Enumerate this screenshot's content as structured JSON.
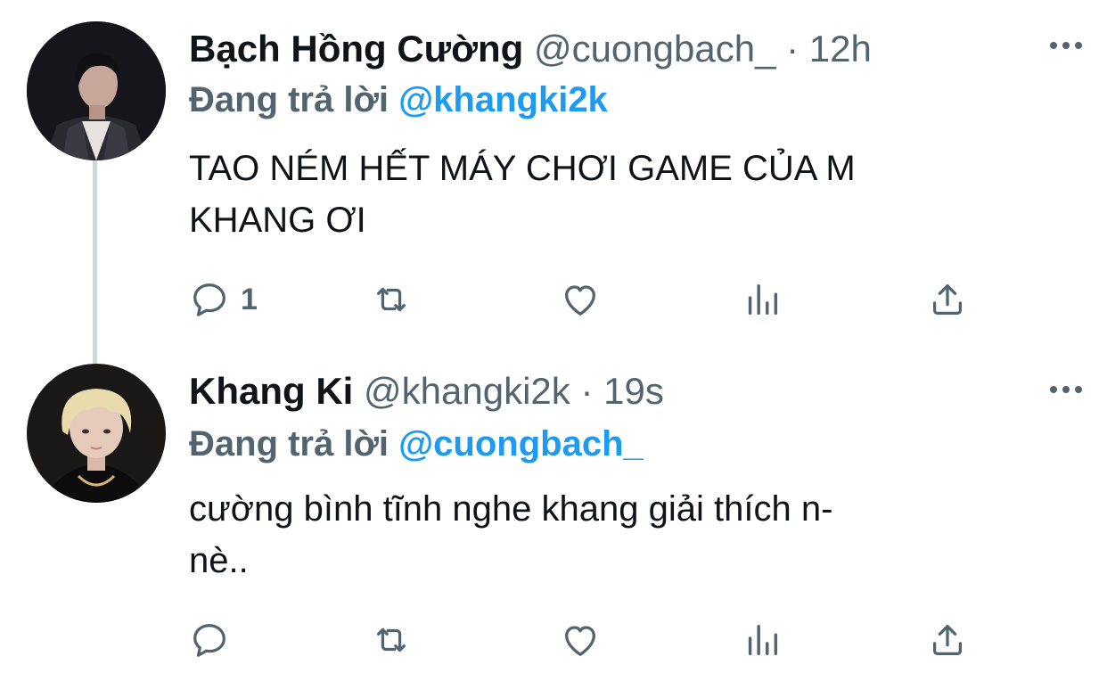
{
  "tweets": [
    {
      "display_name": "Bạch Hồng Cường",
      "handle": "@cuongbach_",
      "separator": "·",
      "time": "12h",
      "replying_prefix": "Đang trả lời",
      "replying_to": "@khangki2k",
      "text": "TAO NÉM HẾT MÁY CHƠI GAME CỦA M\nKHANG ƠI",
      "reply_count": "1"
    },
    {
      "display_name": "Khang Ki",
      "handle": "@khangki2k",
      "separator": "·",
      "time": "19s",
      "replying_prefix": "Đang trả lời",
      "replying_to": "@cuongbach_",
      "text": "cường bình tĩnh nghe khang giải thích n-\nnè..",
      "reply_count": ""
    }
  ],
  "colors": {
    "accent": "#1d9bf0",
    "secondary": "#536471",
    "text": "#0f1419",
    "thread_line": "#cfd9de"
  },
  "icons": {
    "reply": "speech-bubble",
    "retweet": "two-arrows-loop",
    "like": "heart",
    "views": "bar-chart",
    "share": "upload-arrow",
    "more": "three-dots"
  }
}
